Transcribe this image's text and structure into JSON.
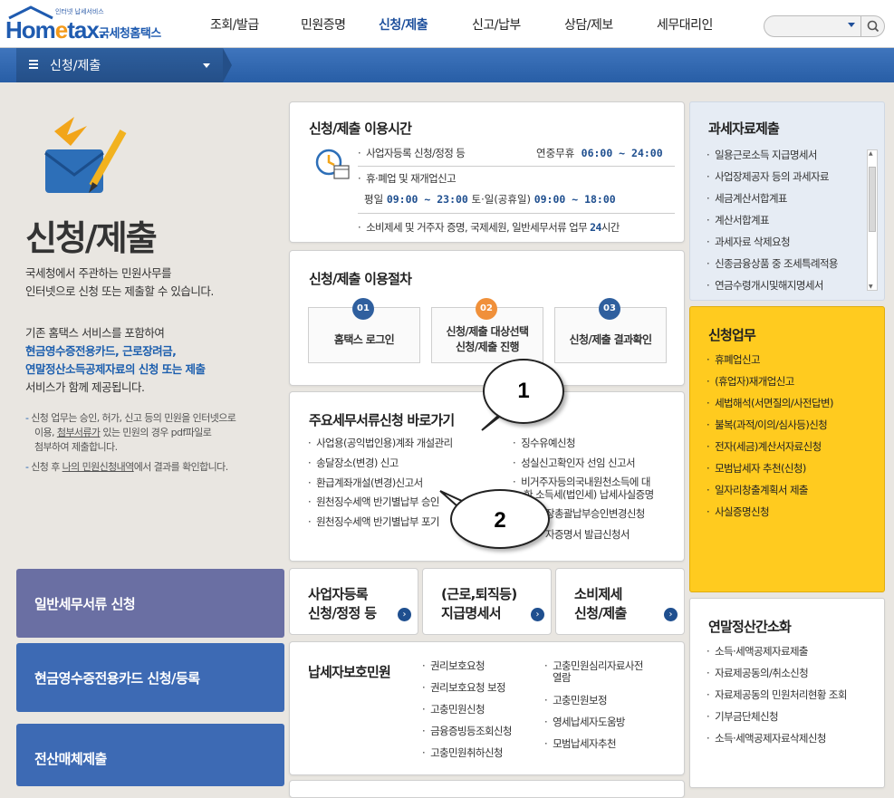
{
  "header": {
    "logo_tagline": "인터넷 납세서비스",
    "logo_word_a": "Hom",
    "logo_word_b": "e",
    "logo_word_c": "tax.",
    "logo_sub": "국세청홈택스",
    "nav": [
      "조회/발급",
      "민원증명",
      "신청/제출",
      "신고/납부",
      "상담/제보",
      "세무대리인"
    ],
    "active_nav": "신청/제출"
  },
  "subnav": {
    "label": "신청/제출"
  },
  "intro": {
    "title": "신청/제출",
    "desc_1": "국세청에서 주관하는 민원사무를",
    "desc_2": "인터넷으로 신청 또는 제출할 수 있습니다.",
    "desc_3": "기존 홈택스 서비스를 포함하여",
    "desc_blue_1": "현금영수증전용카드, 근로장려금,",
    "desc_blue_2": "연말정산소득공제자료의 신청 또는 제출",
    "desc_4": "서비스가 함께 제공됩니다.",
    "note1_a": "신청 업무는 승인, 허가, 신고 등의 민원을 인터넷으로",
    "note1_b": "이용, ",
    "note1_ul": "첨부서류가",
    "note1_c": " 있는 민원의 경우 pdf파일로",
    "note1_d": "첨부하여 제출합니다.",
    "note2_a": "신청 후 ",
    "note2_ul": "나의 민원신청내역",
    "note2_b": "에서 결과를 확인합니다."
  },
  "left_buttons": [
    "일반세무서류 신청",
    "현금영수증전용카드 신청/등록",
    "전산매체제출"
  ],
  "hours": {
    "title": "신청/제출 이용시간",
    "row1_label": "사업자등록 신청/정정 등",
    "row1_note": "연중무휴",
    "row1_time": "06:00 ~ 24:00",
    "row2_label": "휴·폐업 및 재개업신고",
    "row3_a": "평일",
    "row3_t1": "09:00 ~ 23:00",
    "row3_b": "토·일(공휴일)",
    "row3_t2": "09:00 ~ 18:00",
    "row4_a": "소비제세 및 거주자 증명, 국제세원, 일반세무서류 업무",
    "row4_b": "24",
    "row4_c": "시간"
  },
  "procedure": {
    "title": "신청/제출 이용절차",
    "steps": [
      {
        "num": "01",
        "line1": "홈택스 로그인",
        "line2": ""
      },
      {
        "num": "02",
        "line1": "신청/제출 대상선택",
        "line2": "신청/제출 진행"
      },
      {
        "num": "03",
        "line1": "신청/제출 결과확인",
        "line2": ""
      }
    ]
  },
  "shortcuts": {
    "title": "주요세무서류신청 바로가기",
    "left": [
      "사업용(공익법인용)계좌 개설관리",
      "송달장소(변경) 신고",
      "환급계좌개설(변경)신고서",
      "원천징수세액 반기별납부 승인",
      "원천징수세액 반기별납부 포기"
    ],
    "right": [
      "징수유예신청",
      "성실신고확인자 선임 신고서",
      "비거주자등의국내원천소득에 대",
      "한 소득세(법인세) 납세사실증명",
      "장총괄납부승인변경신청",
      "자증명서 발급신청서"
    ]
  },
  "callouts": [
    "1",
    "2"
  ],
  "quick": [
    {
      "line1": "사업자등록",
      "line2": "신청/정정 등"
    },
    {
      "line1": "(근로,퇴직등)",
      "line2": "지급명세서"
    },
    {
      "line1": "소비제세",
      "line2": "신청/제출"
    }
  ],
  "protection": {
    "title": "납세자보호민원",
    "left": [
      "권리보호요청",
      "권리보호요청 보정",
      "고충민원신청",
      "금융증빙등조회신청",
      "고충민원취하신청"
    ],
    "right_a": "고충민원심리자료사전",
    "right_a2": "열람",
    "right": [
      "고충민원보정",
      "영세납세자도움방",
      "모범납세자추천"
    ]
  },
  "tax_data": {
    "title": "과세자료제출",
    "items": [
      "일용근로소득 지급명세서",
      "사업장제공자 등의 과세자료",
      "세금계산서합계표",
      "계산서합계표",
      "과세자료 삭제요청",
      "신종금융상품 중 조세특례적용",
      "연금수령개시및해지명세서"
    ]
  },
  "apply": {
    "title": "신청업무",
    "items": [
      "휴폐업신고",
      "(휴업자)재개업신고",
      "세법해석(서면질의/사전답변)",
      "불복(과적/이의/심사등)신청",
      "전자(세금)계산서자료신청",
      "모범납세자 추천(신청)",
      "일자리창출계획서 제출",
      "사실증명신청"
    ]
  },
  "yearend": {
    "title": "연말정산간소화",
    "items": [
      "소득·세액공제자료제출",
      "자료제공동의/취소신청",
      "자료제공동의 민원처리현황 조회",
      "기부금단체신청",
      "소득·세액공제자료삭제신청"
    ]
  },
  "colors": {
    "brand": "#1f5bb0",
    "nav_blue": "#2f64ad",
    "yellow": "#ffcb1f",
    "btn_purple": "#6a6fa3",
    "btn_blue": "#3d6ab4"
  }
}
